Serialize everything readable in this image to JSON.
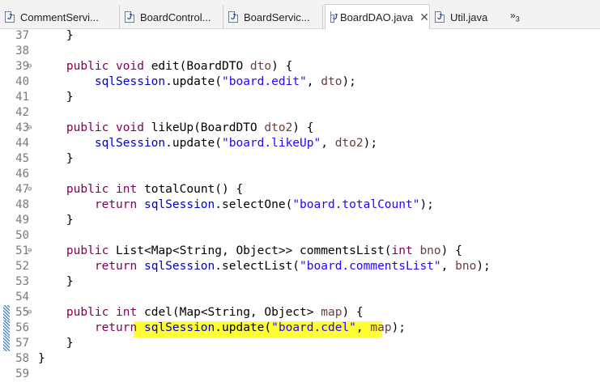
{
  "tabs": [
    {
      "label": "CommentServi...",
      "active": false
    },
    {
      "label": "BoardControl...",
      "active": false
    },
    {
      "label": "BoardServic...",
      "active": false
    },
    {
      "label": "BoardDAO.java",
      "active": true
    },
    {
      "label": "Util.java",
      "active": false
    }
  ],
  "tab_overflow": {
    "symbol": "»",
    "count": "3"
  },
  "editor": {
    "file": "BoardDAO.java",
    "lines": [
      {
        "n": "37",
        "text": "    }"
      },
      {
        "n": "38",
        "text": ""
      },
      {
        "n": "39",
        "text": "    public void edit(BoardDTO dto) {"
      },
      {
        "n": "40",
        "text": "        sqlSession.update(\"board.edit\", dto);"
      },
      {
        "n": "41",
        "text": "    }"
      },
      {
        "n": "42",
        "text": ""
      },
      {
        "n": "43",
        "text": "    public void likeUp(BoardDTO dto2) {"
      },
      {
        "n": "44",
        "text": "        sqlSession.update(\"board.likeUp\", dto2);"
      },
      {
        "n": "45",
        "text": "    }"
      },
      {
        "n": "46",
        "text": ""
      },
      {
        "n": "47",
        "text": "    public int totalCount() {"
      },
      {
        "n": "48",
        "text": "        return sqlSession.selectOne(\"board.totalCount\");"
      },
      {
        "n": "49",
        "text": "    }"
      },
      {
        "n": "50",
        "text": ""
      },
      {
        "n": "51",
        "text": "    public List<Map<String, Object>> commentsList(int bno) {"
      },
      {
        "n": "52",
        "text": "        return sqlSession.selectList(\"board.commentsList\", bno);"
      },
      {
        "n": "53",
        "text": "    }"
      },
      {
        "n": "54",
        "text": ""
      },
      {
        "n": "55",
        "text": "    public int cdel(Map<String, Object> map) {"
      },
      {
        "n": "56",
        "text": "        return sqlSession.update(\"board.cdel\", map);"
      },
      {
        "n": "57",
        "text": "    }"
      },
      {
        "n": "58",
        "text": "}"
      },
      {
        "n": "59",
        "text": ""
      }
    ]
  },
  "colors": {
    "keyword": "#7f0055",
    "field": "#0000c0",
    "string": "#2a00ff",
    "param": "#6a3e3e",
    "highlight": "#ffff33"
  }
}
